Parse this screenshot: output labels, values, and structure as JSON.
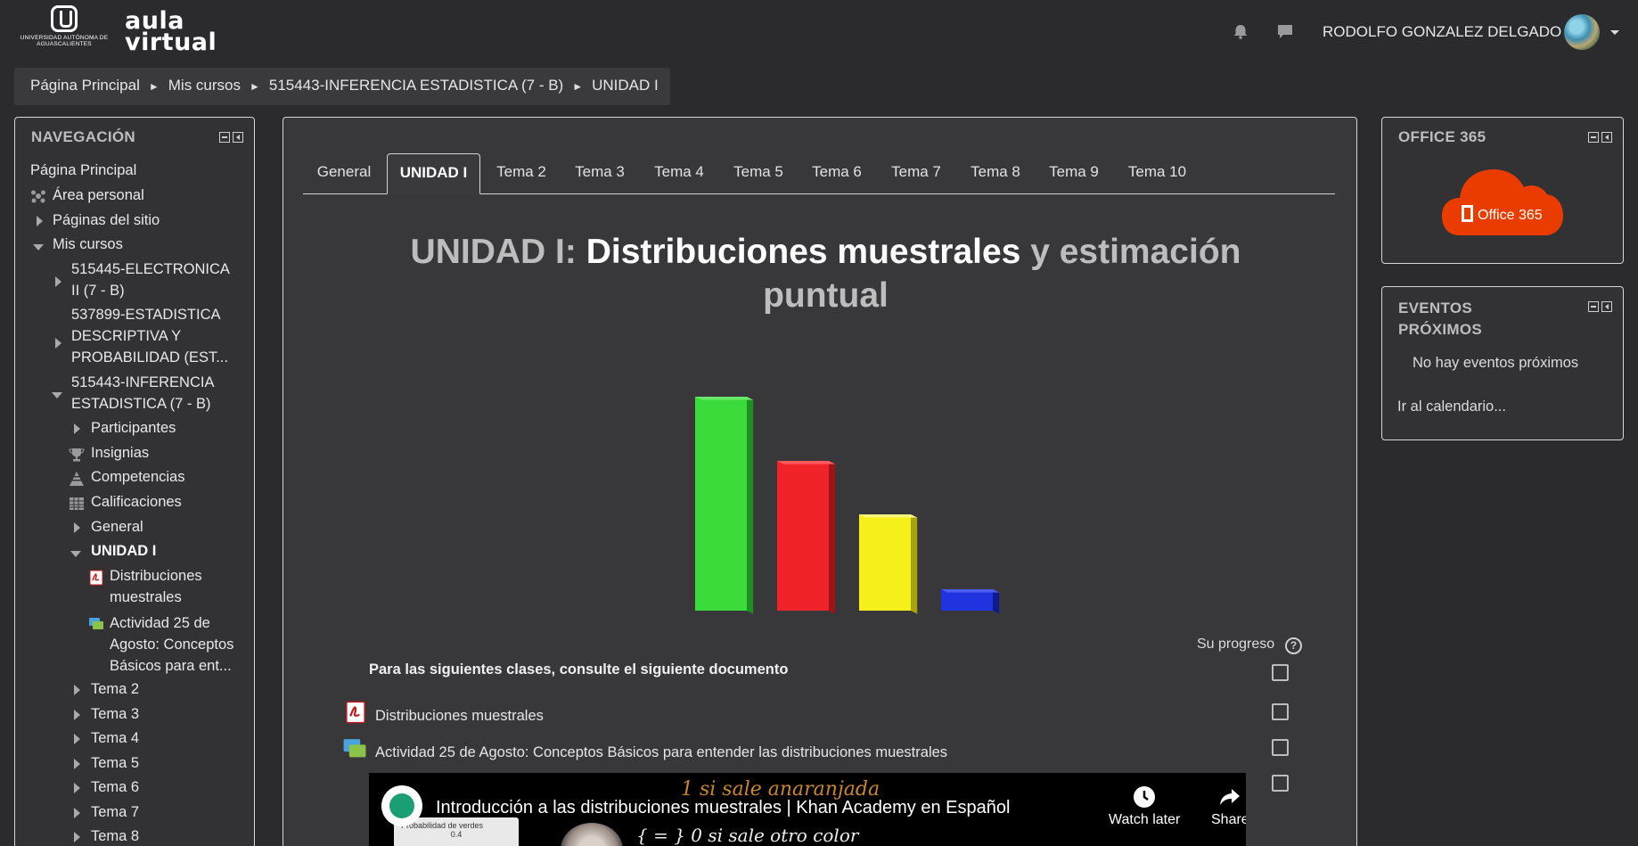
{
  "header": {
    "uaa_logo_text": "UNIVERSIDAD AUTÓNOMA DE AGUASCALIENTES",
    "aula_line1": "aula",
    "aula_line2": "virtual",
    "icons": [
      "notifications-icon",
      "messages-icon"
    ],
    "user_name": "RODOLFO GONZALEZ DELGADO"
  },
  "breadcrumb": [
    "Página Principal",
    "Mis cursos",
    "515443-INFERENCIA ESTADISTICA (7 - B)",
    "UNIDAD I"
  ],
  "navigation": {
    "title": "NAVEGACIÓN",
    "items": {
      "home": "Página Principal",
      "dashboard": "Área personal",
      "site_pages": "Páginas del sitio",
      "my_courses": "Mis cursos",
      "course1_l1": "515445-ELECTRONICA",
      "course1_l2": "II (7 - B)",
      "course2_l1": "537899-ESTADISTICA",
      "course2_l2": "DESCRIPTIVA Y",
      "course2_l3": "PROBABILIDAD (EST...",
      "course3_l1": "515443-INFERENCIA",
      "course3_l2": "ESTADISTICA (7 - B)",
      "participants": "Participantes",
      "badges": "Insignias",
      "competencies": "Competencias",
      "grades": "Calificaciones",
      "general": "General",
      "unidad1": "UNIDAD I",
      "res1_l1": "Distribuciones",
      "res1_l2": "muestrales",
      "res2_l1": "Actividad 25 de",
      "res2_l2": "Agosto: Conceptos",
      "res2_l3": "Básicos para ent...",
      "temas": [
        "Tema 2",
        "Tema 3",
        "Tema 4",
        "Tema 5",
        "Tema 6",
        "Tema 7",
        "Tema 8"
      ]
    }
  },
  "tabs": [
    "General",
    "UNIDAD I",
    "Tema 2",
    "Tema 3",
    "Tema 4",
    "Tema 5",
    "Tema 6",
    "Tema 7",
    "Tema 8",
    "Tema 9",
    "Tema 10"
  ],
  "active_tab": "UNIDAD I",
  "section": {
    "title_prefix": "UNIDAD I: ",
    "title_highlight": "Distribuciones muestrales",
    "title_middle": " y estimación",
    "title_line2": "puntual",
    "progress_label": "Su progreso",
    "help_symbol": "?",
    "note": "Para las siguientes clases, consulte  el siguiente documento",
    "activities": [
      "Distribuciones muestrales",
      "Actividad 25 de Agosto: Conceptos Básicos para entender las distribuciones muestrales"
    ],
    "video": {
      "title": "Introducción a las distribuciones muestrales | Khan Academy en Español",
      "watch_later": "Watch later",
      "share": "Share",
      "scribble_top": "1 si sale anaranjada",
      "scribble_bottom": "{ = } 0 si sale otro color",
      "thumb_label": "Probabilidad de verdes",
      "thumb_value": "0.4"
    }
  },
  "decor_chart": {
    "bars": [
      {
        "color": "#3adb3a",
        "side": "#1f8f1f",
        "top": "#6be86b",
        "value": 1.0
      },
      {
        "color": "#f0232a",
        "side": "#9c1418",
        "top": "#ff5a5f",
        "value": 0.7
      },
      {
        "color": "#f6f01a",
        "side": "#a8a20c",
        "top": "#fbf77a",
        "value": 0.45
      },
      {
        "color": "#1f33e0",
        "side": "#101c8e",
        "top": "#4b5cf0",
        "value": 0.1
      }
    ]
  },
  "office365": {
    "title": "OFFICE 365",
    "logo_text": "Office 365",
    "brand_color": "#eb3c00"
  },
  "events": {
    "title_l1": "EVENTOS",
    "title_l2": "PRÓXIMOS",
    "empty": "No hay eventos próximos",
    "calendar_link": "Ir al calendario..."
  }
}
